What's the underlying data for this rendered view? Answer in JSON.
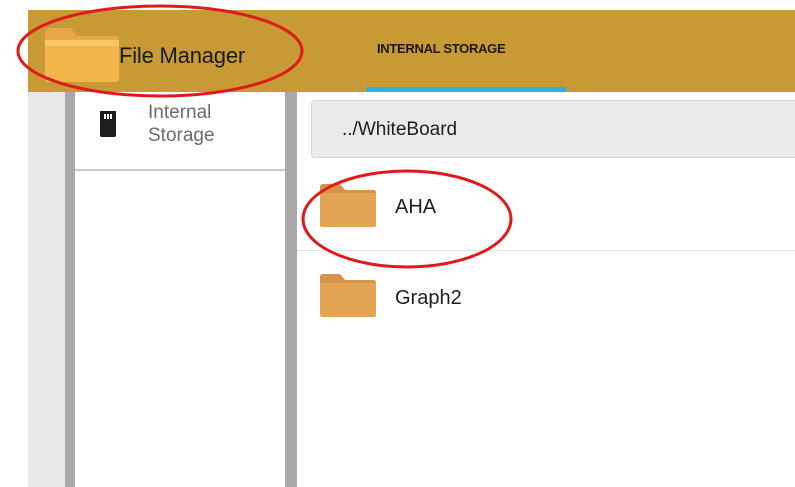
{
  "header": {
    "app_title": "File Manager",
    "tabs": [
      {
        "label": "INTERNAL STORAGE",
        "active": true
      }
    ]
  },
  "sidebar": {
    "items": [
      {
        "label": "Internal\nStorage",
        "icon": "sd-card-icon"
      }
    ]
  },
  "main": {
    "path": "../WhiteBoard",
    "files": [
      {
        "name": "AHA",
        "type": "folder",
        "icon": "folder-icon"
      },
      {
        "name": "Graph2",
        "type": "folder",
        "icon": "folder-icon"
      }
    ]
  },
  "colors": {
    "header_bg": "#c89a36",
    "tab_indicator": "#2bb0e8",
    "folder": "#e3a553",
    "annotation": "#e01a1a",
    "divider": "#a9a9a9"
  }
}
